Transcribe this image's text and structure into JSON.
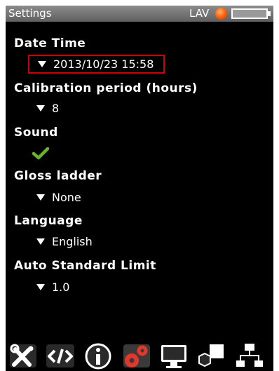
{
  "titlebar": {
    "title": "Settings",
    "mode": "LAV",
    "status_icon": "orange-status-dot",
    "battery_icon": "battery-icon"
  },
  "settings": {
    "date_time": {
      "label": "Date Time",
      "value": "2013/10/23 15:58"
    },
    "calibration": {
      "label": "Calibration period (hours)",
      "value": "8"
    },
    "sound": {
      "label": "Sound",
      "value_icon": "checkmark-icon"
    },
    "gloss_ladder": {
      "label": "Gloss ladder",
      "value": "None"
    },
    "language": {
      "label": "Language",
      "value": "English"
    },
    "auto_standard": {
      "label": "Auto Standard Limit",
      "value": "1.0"
    }
  },
  "toolbar": {
    "items": [
      "tools-icon",
      "code-icon",
      "info-icon",
      "settings-gears-icon",
      "monitor-icon",
      "shapes-icon",
      "network-icon"
    ]
  },
  "colors": {
    "background": "#000000",
    "selection_border": "#d00000",
    "check": "#6ab52f",
    "active_gears": "#e5362b"
  }
}
